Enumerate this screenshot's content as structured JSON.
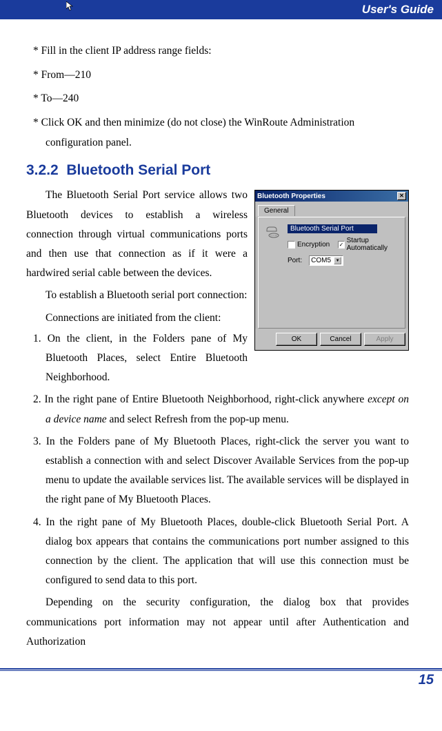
{
  "header": {
    "title": "User's Guide"
  },
  "intro": {
    "line1": "* Fill in the client IP address range fields:",
    "line2": "* From—210",
    "line3": "* To—240",
    "line4": "* Click OK and then minimize (do not close) the WinRoute Administration",
    "line4b": "configuration panel."
  },
  "section": {
    "number": "3.2.2",
    "title": "Bluetooth Serial Port"
  },
  "para1": "The Bluetooth Serial Port service allows two Bluetooth devices to establish a wireless connection through virtual communications ports and then use that connection as if it were a hardwired serial cable between the devices.",
  "para2": "To establish a Bluetooth serial port connection:",
  "para3": "Connections are initiated from the client:",
  "steps": {
    "s1a": "1. On the client, in the Folders pane of",
    "s1b": "My Bluetooth Places, select Entire Bluetooth Neighborhood.",
    "s2a": "2. In the right pane of Entire Bluetooth Neighborhood, right-click anywhere ",
    "s2b": "except on a device name",
    "s2c": " and select Refresh from the pop-up menu.",
    "s3": "3. In the Folders pane of My Bluetooth Places, right-click the server you want to establish a connection with and select Discover Available Services from the pop-up menu to update the available services list. The available services will be displayed in the right pane of My Bluetooth Places.",
    "s4": "4. In the right pane of My Bluetooth Places, double-click Bluetooth Serial Port. A dialog box appears that contains the communications port number assigned to this connection by the client. The application that will use this connection must be configured to send data to this port."
  },
  "para4": "Depending on the security configuration, the dialog box that provides communications port information may not appear until after Authentication and Authorization",
  "dialog": {
    "title": "Bluetooth Properties",
    "tab": "General",
    "service": "Bluetooth Serial Port",
    "encryption": "Encryption",
    "startup": "Startup Automatically",
    "portLabel": "Port:",
    "portValue": "COM5",
    "ok": "OK",
    "cancel": "Cancel",
    "apply": "Apply"
  },
  "footer": {
    "page": "15"
  }
}
